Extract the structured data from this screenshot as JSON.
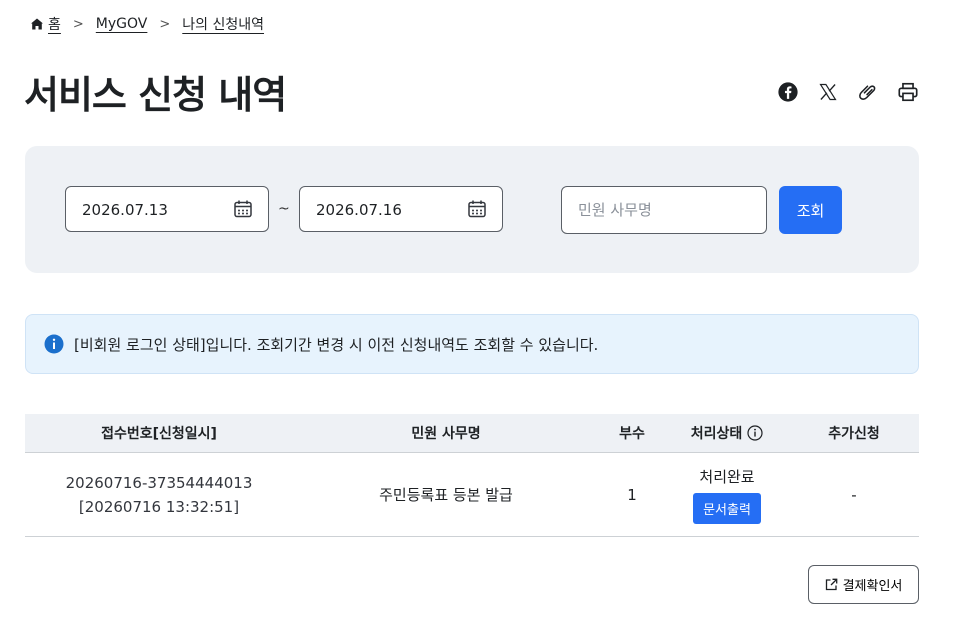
{
  "breadcrumb": {
    "home": "홈",
    "level1": "MyGOV",
    "level2": "나의 신청내역"
  },
  "page": {
    "title": "서비스 신청 내역"
  },
  "share_icons": [
    "facebook-icon",
    "x-icon",
    "link-icon",
    "print-icon"
  ],
  "search": {
    "start_date": "2026.07.13",
    "separator": "~",
    "end_date": "2026.07.16",
    "keyword_placeholder": "민원 사무명",
    "keyword_value": "",
    "button_label": "조회"
  },
  "notice": {
    "text": "[비회원 로그인 상태]입니다. 조회기간 변경 시 이전 신청내역도 조회할 수 있습니다."
  },
  "table": {
    "headers": [
      "접수번호[신청일시]",
      "민원 사무명",
      "부수",
      "처리상태",
      "추가신청"
    ],
    "rows": [
      {
        "receipt_no": "20260716-37354444013",
        "applied_at": "[20260716 13:32:51]",
        "service_name": "주민등록표 등본 발급",
        "copies": "1",
        "status": "처리완료",
        "print_label": "문서출력",
        "additional": "-"
      }
    ]
  },
  "footer": {
    "confirm_button": "결제확인서"
  },
  "colors": {
    "primary": "#256ef4",
    "panel_bg": "#eef1f5",
    "notice_bg": "#e7f3fd",
    "text": "#1e2124"
  }
}
